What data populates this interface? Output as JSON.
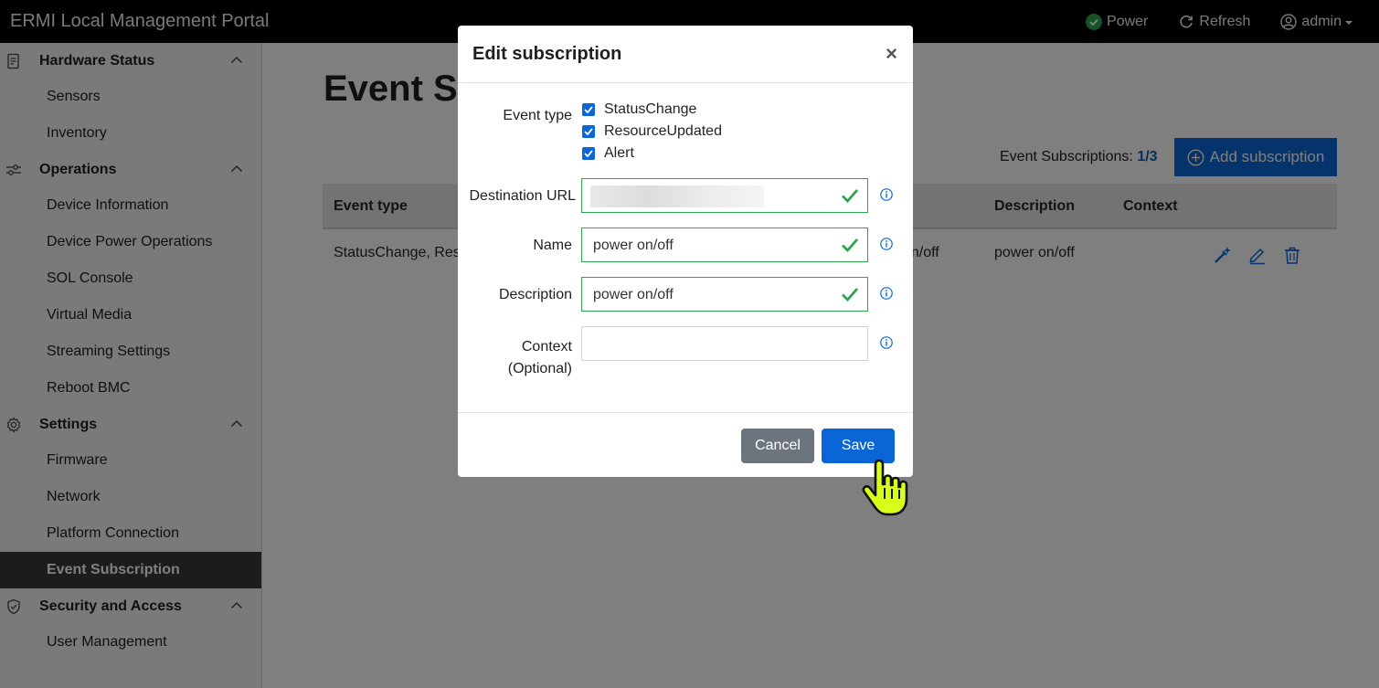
{
  "header": {
    "title": "ERMI Local Management Portal",
    "power_label": "Power",
    "refresh_label": "Refresh",
    "user_label": "admin"
  },
  "sidebar": {
    "sections": [
      {
        "label": "Hardware Status",
        "items": [
          "Sensors",
          "Inventory"
        ]
      },
      {
        "label": "Operations",
        "items": [
          "Device Information",
          "Device Power Operations",
          "SOL Console",
          "Virtual Media",
          "Streaming Settings",
          "Reboot BMC"
        ]
      },
      {
        "label": "Settings",
        "items": [
          "Firmware",
          "Network",
          "Platform Connection",
          "Event Subscription"
        ]
      },
      {
        "label": "Security and Access",
        "items": [
          "User Management"
        ]
      }
    ],
    "active_item": "Event Subscription"
  },
  "main": {
    "page_title": "Event Su",
    "count_label": "Event Subscriptions:",
    "count_value": "1/3",
    "add_button": "Add subscription",
    "table": {
      "headers": [
        "Event type",
        "Description",
        "Context"
      ],
      "row": {
        "event_type": "StatusChange, Reso",
        "name_fragment": "on/off",
        "description": "power on/off",
        "context": ""
      }
    }
  },
  "modal": {
    "title": "Edit subscription",
    "close": "×",
    "event_type_label": "Event type",
    "event_types": [
      "StatusChange",
      "ResourceUpdated",
      "Alert"
    ],
    "destination_label": "Destination URL",
    "name_label": "Name",
    "name_value": "power on/off",
    "description_label": "Description",
    "description_value": "power on/off",
    "context_label_1": "Context",
    "context_label_2": "(Optional)",
    "context_value": "",
    "cancel_label": "Cancel",
    "save_label": "Save"
  },
  "colors": {
    "primary": "#0a66d6",
    "valid": "#2ea44f",
    "secondary": "#6c757d",
    "power_status": "#2ea44f"
  }
}
